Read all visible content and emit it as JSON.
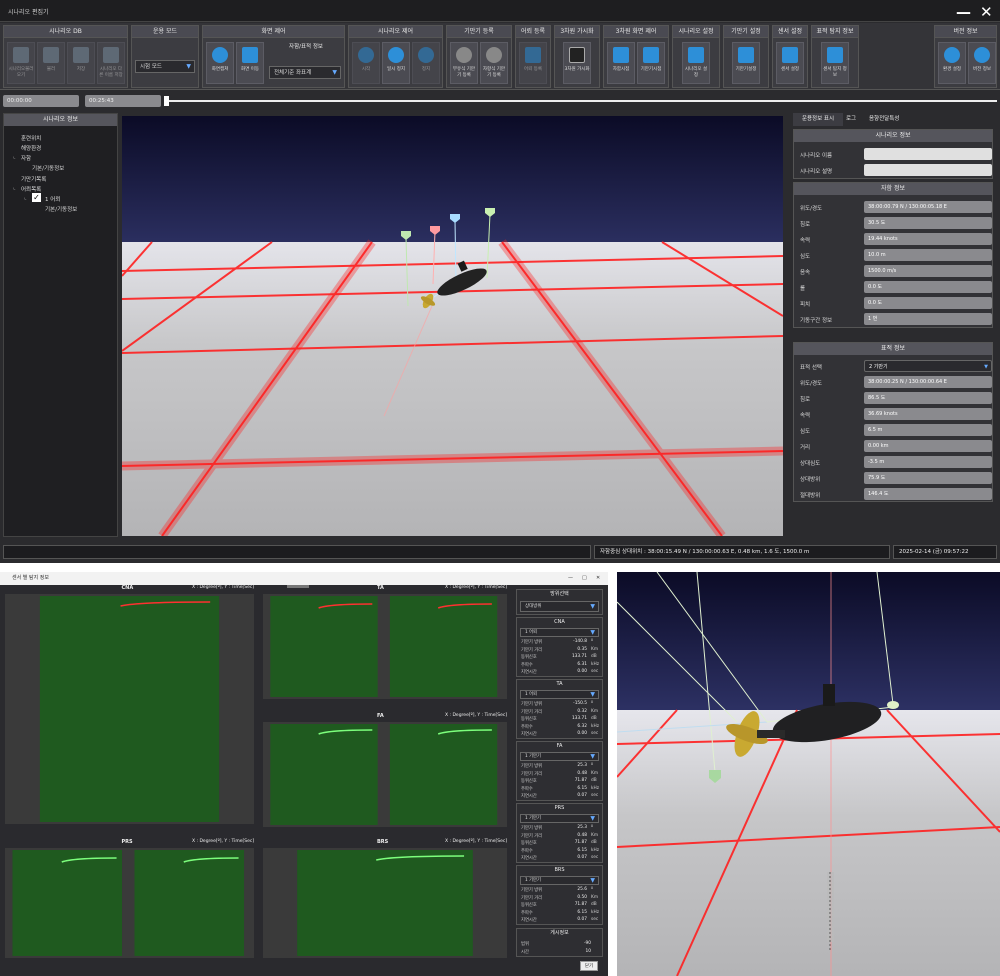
{
  "app": {
    "title": "시나리오 편집기"
  },
  "toolbar": {
    "groups": [
      {
        "title": "시나리오 DB",
        "buttons": [
          "시나리오불러오기",
          "불러",
          "저장",
          "시나리오 다른 이름 저장"
        ]
      },
      {
        "title": "운용 모드",
        "select": "시험 모드"
      },
      {
        "title": "화면 제어",
        "buttons": [
          "화면캡쳐",
          "화면 이동"
        ],
        "sub_title": "자함/표적 정보",
        "sub_select": "전체기준 좌표계"
      },
      {
        "title": "시나리오 제어",
        "buttons": [
          "시작",
          "일시 정지",
          "정지"
        ]
      },
      {
        "title": "기만기 등록",
        "buttons": [
          "부유식 기만기 등록",
          "자항식 기만기 등록"
        ]
      },
      {
        "title": "어뢰 등록",
        "buttons": [
          "어뢰 등록"
        ]
      },
      {
        "title": "3차원 가시화",
        "buttons": [
          "3차원 가시화"
        ]
      },
      {
        "title": "3차원 화면 제어",
        "buttons": [
          "자함시점",
          "기만기시점"
        ]
      },
      {
        "title": "시나리오 설정",
        "buttons": [
          "시나리오 설정"
        ]
      },
      {
        "title": "기만기 설정",
        "buttons": [
          "기만기설정"
        ]
      },
      {
        "title": "센서 설정",
        "buttons": [
          "센서 설정"
        ]
      },
      {
        "title": "표적 탐지 정보",
        "buttons": [
          "센서 탐지 정보"
        ]
      },
      {
        "title": "버전 정보",
        "buttons": [
          "환경 설정",
          "버전 정보"
        ]
      }
    ]
  },
  "timeline": {
    "start": "00:00:00",
    "current": "00:25:43",
    "progress": 0.0
  },
  "tree": {
    "title": "시나리오 정보",
    "items": [
      "훈련위치",
      "해양환경",
      "자함",
      "기본/기동정보",
      "기만기목록",
      "어뢰목록",
      "1 어뢰",
      "기본/기동정보"
    ]
  },
  "right_panel": {
    "tabs": [
      "운용정보 표시",
      "로그",
      "음향전달특성"
    ],
    "scenario": {
      "title": "시나리오 정보",
      "rows": [
        {
          "k": "시나리오 이름",
          "v": ""
        },
        {
          "k": "시나리오 설명",
          "v": ""
        }
      ]
    },
    "ship": {
      "title": "자함 정보",
      "rows": [
        {
          "k": "위도/경도",
          "v": "38:00:00.79 N / 130:00:05.18 E"
        },
        {
          "k": "침로",
          "v": "30.5 도"
        },
        {
          "k": "속력",
          "v": "19.44 knots"
        },
        {
          "k": "심도",
          "v": "10.0 m"
        },
        {
          "k": "음속",
          "v": "1500.0 m/s"
        },
        {
          "k": "롤",
          "v": "0.0 도"
        },
        {
          "k": "피치",
          "v": "0.0 도"
        },
        {
          "k": "기동구간 정보",
          "v": "1 번"
        }
      ]
    },
    "target": {
      "title": "표적 정보",
      "select_label": "표적 선택",
      "select": "2 기만기",
      "rows": [
        {
          "k": "위도/경도",
          "v": "38:00:00.25 N / 130:00:00.64 E"
        },
        {
          "k": "침로",
          "v": "86.5 도"
        },
        {
          "k": "속력",
          "v": "36.69 knots"
        },
        {
          "k": "심도",
          "v": "6.5 m"
        },
        {
          "k": "거리",
          "v": "0.00 km"
        },
        {
          "k": "상대심도",
          "v": "-3.5 m"
        },
        {
          "k": "상대방위",
          "v": "75.9 도"
        },
        {
          "k": "절대방위",
          "v": "146.4 도"
        }
      ]
    }
  },
  "status": {
    "left": "",
    "center": "자함중심 상대위치 : 38:00:15.49 N / 130:00:00.63 E, 0.48 km, 1.6 도, 1500.0 m",
    "datetime": "2025-02-14 (금) 09:57:22"
  },
  "sensor_window": {
    "title": "센서 별 탐지 정보",
    "axis_note": "X : Degree[º], Y : Time[Sec]",
    "plots": [
      "CNA",
      "TA",
      "FA",
      "PRS",
      "BRS"
    ],
    "side_title": "방위선택",
    "side_select": "상대방위",
    "sections": [
      {
        "name": "CNA",
        "select": "1 어뢰",
        "rows": [
          [
            "기만기 방위",
            "-140.8",
            "º"
          ],
          [
            "기만기 거리",
            "0.35",
            "Km"
          ],
          [
            "동위신호",
            "133.71",
            "dB"
          ],
          [
            "주파수",
            "6.31",
            "kHz"
          ],
          [
            "지연시간",
            "0.00",
            "sec"
          ]
        ]
      },
      {
        "name": "TA",
        "select": "1 어뢰",
        "rows": [
          [
            "기만기 방위",
            "-150.5",
            "º"
          ],
          [
            "기만기 거리",
            "0.32",
            "Km"
          ],
          [
            "동위신호",
            "133.71",
            "dB"
          ],
          [
            "주파수",
            "6.32",
            "kHz"
          ],
          [
            "지연시간",
            "0.00",
            "sec"
          ]
        ]
      },
      {
        "name": "FA",
        "select": "1 기만기",
        "rows": [
          [
            "기만기 방위",
            "25.3",
            "º"
          ],
          [
            "기만기 거리",
            "0.48",
            "Km"
          ],
          [
            "동위신호",
            "71.87",
            "dB"
          ],
          [
            "주파수",
            "6.15",
            "kHz"
          ],
          [
            "지연시간",
            "0.07",
            "sec"
          ]
        ]
      },
      {
        "name": "PRS",
        "select": "1 기만기",
        "rows": [
          [
            "기만기 방위",
            "25.3",
            "º"
          ],
          [
            "기만기 거리",
            "0.48",
            "Km"
          ],
          [
            "동위신호",
            "71.87",
            "dB"
          ],
          [
            "주파수",
            "6.15",
            "kHz"
          ],
          [
            "지연시간",
            "0.07",
            "sec"
          ]
        ]
      },
      {
        "name": "BRS",
        "select": "1 기만기",
        "rows": [
          [
            "기만기 방위",
            "25.6",
            "º"
          ],
          [
            "기만기 거리",
            "0.50",
            "Km"
          ],
          [
            "동위신호",
            "71.87",
            "dB"
          ],
          [
            "주파수",
            "6.15",
            "kHz"
          ],
          [
            "지연시간",
            "0.07",
            "sec"
          ]
        ]
      }
    ],
    "display": {
      "title": "게시정보",
      "rows": [
        [
          "범위",
          "-90"
        ],
        [
          "시간",
          "10"
        ]
      ],
      "close": "닫기"
    }
  }
}
